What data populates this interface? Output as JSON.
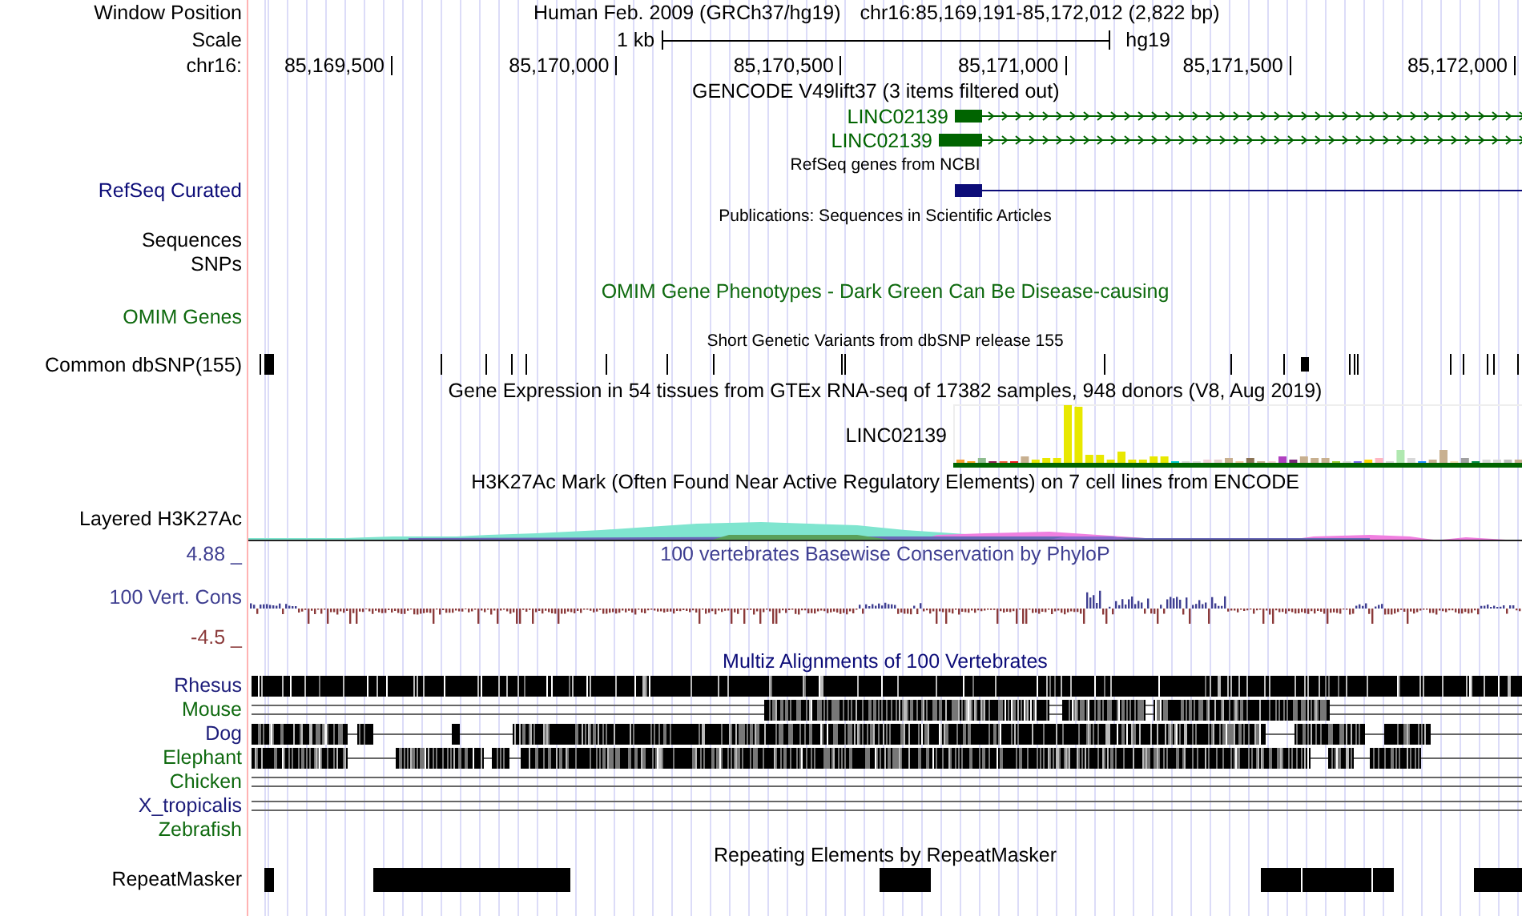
{
  "header": {
    "label": "Window Position",
    "assembly": "Human Feb. 2009 (GRCh37/hg19)",
    "position": "chr16:85,169,191-85,172,012 (2,822 bp)"
  },
  "scale": {
    "label": "Scale",
    "length": "1 kb",
    "assembly": "hg19"
  },
  "ruler": {
    "label": "chr16:",
    "ticks": [
      "85,169,500",
      "85,170,000",
      "85,170,500",
      "85,171,000",
      "85,171,500",
      "85,172,000"
    ]
  },
  "tracks": [
    {
      "kind": "gencode",
      "title": "GENCODE V49lift37 (3 items filtered out)",
      "color": "#006400",
      "genes": [
        "LINC02139",
        "LINC02139"
      ]
    },
    {
      "kind": "refseq",
      "label": "RefSeq Curated",
      "title": "RefSeq genes from NCBI",
      "color": "#0c0c78"
    },
    {
      "kind": "title",
      "title": "Publications: Sequences in Scientific Articles"
    },
    {
      "kind": "label",
      "label": "Sequences"
    },
    {
      "kind": "label",
      "label": "SNPs"
    },
    {
      "kind": "omim",
      "label": "OMIM Genes",
      "title": "OMIM Gene Phenotypes - Dark Green Can Be Disease-causing",
      "color": "#0f6a0f"
    },
    {
      "kind": "snp",
      "label": "Common dbSNP(155)",
      "title": "Short Genetic Variants from dbSNP release 155"
    },
    {
      "kind": "gtex",
      "title": "Gene Expression in 54 tissues from GTEx RNA-seq of 17382 samples, 948 donors (V8, Aug 2019)",
      "gene": "LINC02139"
    },
    {
      "kind": "h3k27ac",
      "label": "Layered H3K27Ac",
      "title": "H3K27Ac Mark (Often Found Near Active Regulatory Elements) on 7 cell lines from ENCODE"
    },
    {
      "kind": "phylop",
      "title": "100 vertebrates Basewise Conservation by PhyloP",
      "label": "100 Vert. Cons",
      "max": "4.88 _",
      "min": "-4.5 _",
      "color": "#3f3f91"
    },
    {
      "kind": "multiz",
      "title": "Multiz Alignments of 100 Vertebrates",
      "color": "#0c0c78",
      "species": [
        {
          "name": "Rhesus",
          "color": "#1c1c7a"
        },
        {
          "name": "Mouse",
          "color": "#0f6a0f"
        },
        {
          "name": "Dog",
          "color": "#1c1c7a"
        },
        {
          "name": "Elephant",
          "color": "#0f6a0f"
        },
        {
          "name": "Chicken",
          "color": "#0f6a0f"
        },
        {
          "name": "X_tropicalis",
          "color": "#1c1c7a"
        },
        {
          "name": "Zebrafish",
          "color": "#0f6a0f"
        }
      ]
    },
    {
      "kind": "repeatmasker",
      "label": "RepeatMasker",
      "title": "Repeating Elements by RepeatMasker"
    }
  ]
}
